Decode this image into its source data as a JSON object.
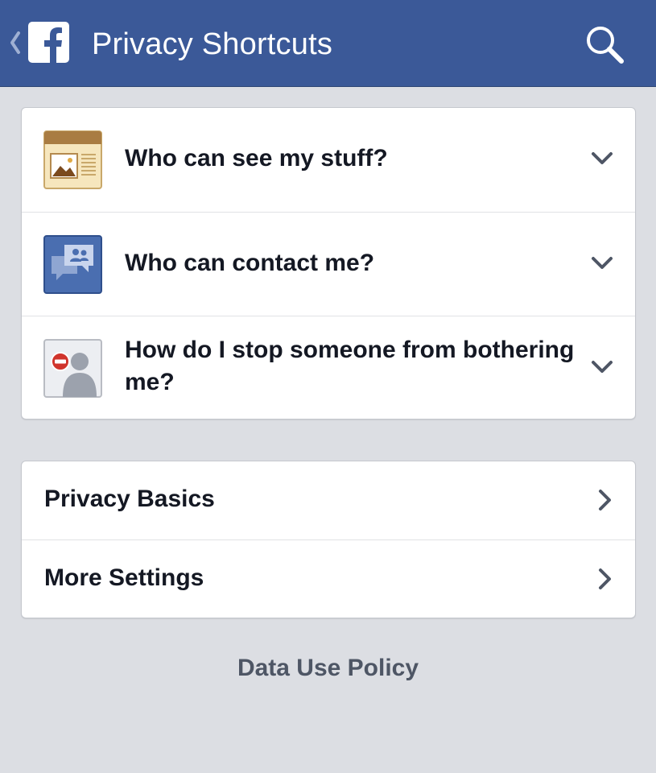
{
  "header": {
    "title": "Privacy Shortcuts",
    "back_icon": "chevron-left-icon",
    "logo_icon": "facebook-logo-icon",
    "search_icon": "search-icon",
    "background_color": "#3b5998"
  },
  "shortcuts": [
    {
      "label": "Who can see my stuff?",
      "icon": "newspaper-photo-icon",
      "action_icon": "chevron-down-icon"
    },
    {
      "label": "Who can contact me?",
      "icon": "friends-messages-icon",
      "action_icon": "chevron-down-icon"
    },
    {
      "label": "How do I stop someone from bothering me?",
      "icon": "block-person-icon",
      "action_icon": "chevron-down-icon"
    }
  ],
  "links": [
    {
      "label": "Privacy Basics",
      "action_icon": "chevron-right-icon"
    },
    {
      "label": "More Settings",
      "action_icon": "chevron-right-icon"
    }
  ],
  "footer": {
    "link": "Data Use Policy"
  },
  "colors": {
    "page_background": "#dcdee3",
    "text": "#141823",
    "footer_text": "#4e5665"
  }
}
